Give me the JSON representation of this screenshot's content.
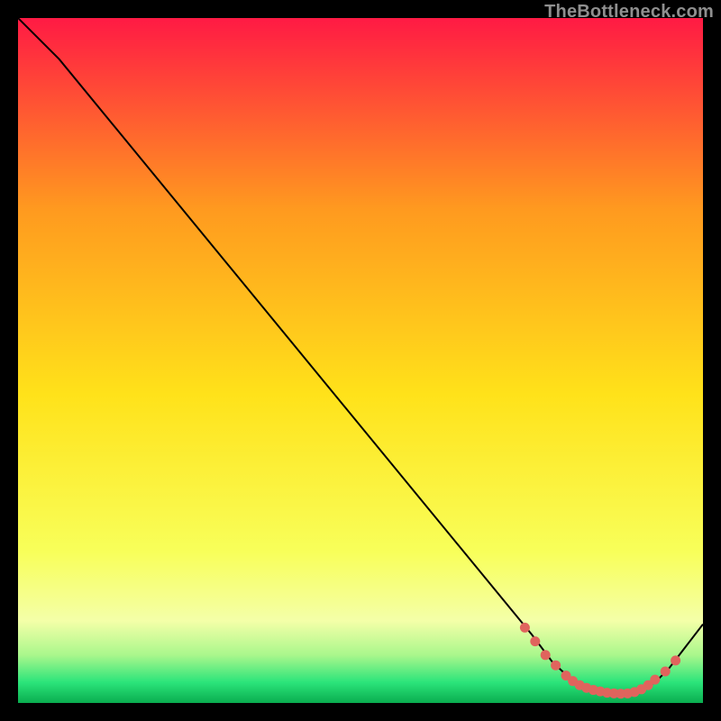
{
  "watermark": "TheBottleneck.com",
  "colors": {
    "background": "#000000",
    "curve": "#000000",
    "curve_highlight": "#e0645d",
    "gradient_top": "#ff1a44",
    "gradient_upper_mid": "#ff9a1f",
    "gradient_mid": "#ffe21a",
    "gradient_lower_mid": "#f8ff5a",
    "gradient_soft": "#f4ffa8",
    "gradient_green_upper": "#aaf78c",
    "gradient_green": "#2be47a",
    "gradient_green_dark": "#0aad4f"
  },
  "chart_data": {
    "type": "line",
    "title": "",
    "xlabel": "",
    "ylabel": "",
    "xlim": [
      0,
      100
    ],
    "ylim": [
      0,
      100
    ],
    "series": [
      {
        "name": "bottleneck-curve",
        "x": [
          0,
          6,
          75,
          78,
          81,
          84,
          86,
          87,
          88,
          90,
          93,
          95,
          100
        ],
        "y": [
          100,
          94,
          10,
          6,
          3.2,
          1.8,
          1.4,
          1.3,
          1.3,
          1.5,
          3.0,
          5.0,
          11.5
        ]
      }
    ],
    "highlight_points": {
      "name": "highlighted-range",
      "x": [
        74,
        75.5,
        77,
        78.5,
        80,
        81,
        82,
        83,
        84,
        85,
        86,
        87,
        88,
        89,
        90,
        91,
        92,
        93,
        94.5,
        96
      ],
      "y": [
        11,
        9.0,
        7.0,
        5.5,
        4.0,
        3.2,
        2.6,
        2.2,
        1.9,
        1.7,
        1.5,
        1.4,
        1.35,
        1.4,
        1.6,
        2.0,
        2.6,
        3.4,
        4.6,
        6.2
      ]
    }
  }
}
